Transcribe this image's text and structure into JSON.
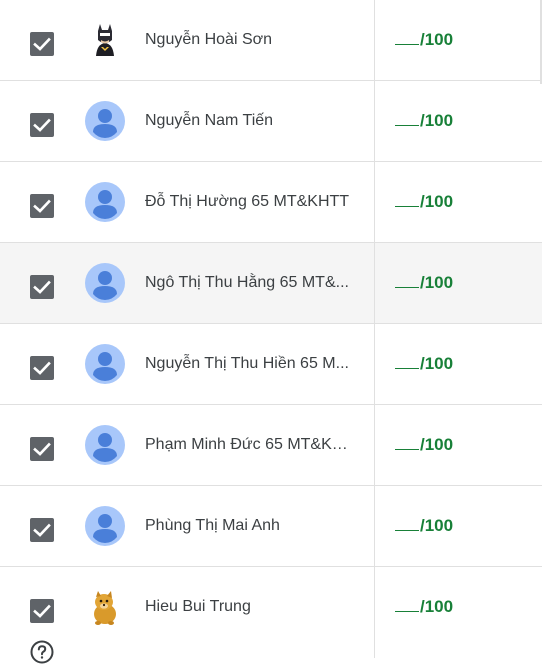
{
  "students": [
    {
      "name": "Nguyễn Hoài Sơn",
      "grade_suffix": "/100",
      "avatar": "batman-avatar",
      "checked": true
    },
    {
      "name": "Nguyễn Nam Tiến",
      "grade_suffix": "/100",
      "avatar": "default-person-avatar",
      "checked": true
    },
    {
      "name": "Đỗ Thị Hường 65 MT&KHTT",
      "grade_suffix": "/100",
      "avatar": "default-person-avatar",
      "checked": true
    },
    {
      "name": "Ngô Thị Thu Hằng 65 MT&...",
      "grade_suffix": "/100",
      "avatar": "default-person-avatar",
      "checked": true
    },
    {
      "name": "Nguyễn Thị Thu Hiền 65 M...",
      "grade_suffix": "/100",
      "avatar": "default-person-avatar",
      "checked": true
    },
    {
      "name": "Phạm Minh Đức 65 MT&KH...",
      "grade_suffix": "/100",
      "avatar": "default-person-avatar",
      "checked": true
    },
    {
      "name": "Phùng Thị Mai Anh",
      "grade_suffix": "/100",
      "avatar": "default-person-avatar",
      "checked": true
    },
    {
      "name": "Hieu Bui Trung",
      "grade_suffix": "/100",
      "avatar": "dog-avatar",
      "checked": true
    }
  ],
  "colors": {
    "grade_green": "#188038",
    "checkbox": "#5f6368",
    "avatar_bg": "#a8c7fa",
    "avatar_fg": "#4a7fd9"
  },
  "icons": {
    "help": "help-circle-icon",
    "checkbox": "check-icon"
  }
}
